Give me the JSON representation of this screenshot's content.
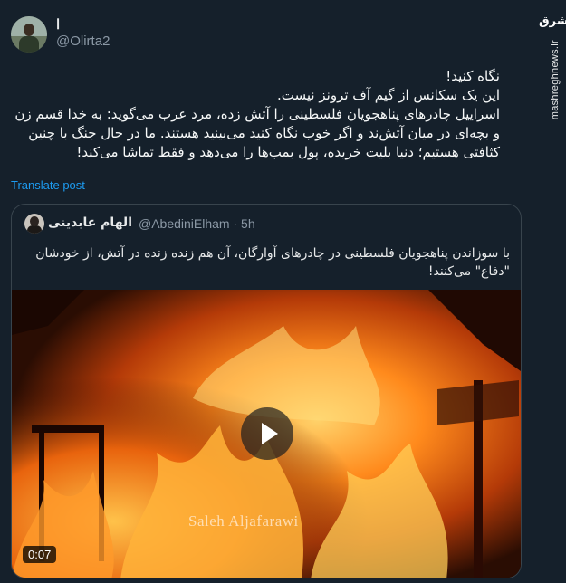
{
  "watermark": {
    "logo_text": "مشرق",
    "site": "mashreghnews.ir"
  },
  "author": {
    "display_name": "ا",
    "handle": "@Olirta2"
  },
  "tweet": {
    "lines": [
      "نگاه کنید!",
      "این یک سکانس از گیم آف ترونز نیست.",
      "اسراییل چادرهای پناهجویان فلسطینی را آتش زده، مرد عرب می‌گوید: به خدا قسم زن و بچه‌ای در میان آتش‌ند و اگر خوب نگاه کنید می‌بینید هستند. ما در حال جنگ با چنین کثافتی هستیم؛ دنیا بلیت خریده، پول بمب‌ها را می‌دهد و فقط تماشا می‌کند!"
    ],
    "translate_label": "Translate post"
  },
  "quote": {
    "name": "الهام عابدینی",
    "handle_time": "@AbediniElham · 5h",
    "text": "با سوزاندن پناهجویان فلسطینی در چادرهای آوارگان، آن هم زنده زنده در آتش، از خودشان \"دفاع\" می‌کنند!",
    "video": {
      "duration": "0:07",
      "credit": "Saleh Aljafarawi"
    }
  },
  "colors": {
    "background": "#15202b",
    "link": "#1d9bf0",
    "muted": "#8b98a5",
    "border": "#38444d"
  }
}
